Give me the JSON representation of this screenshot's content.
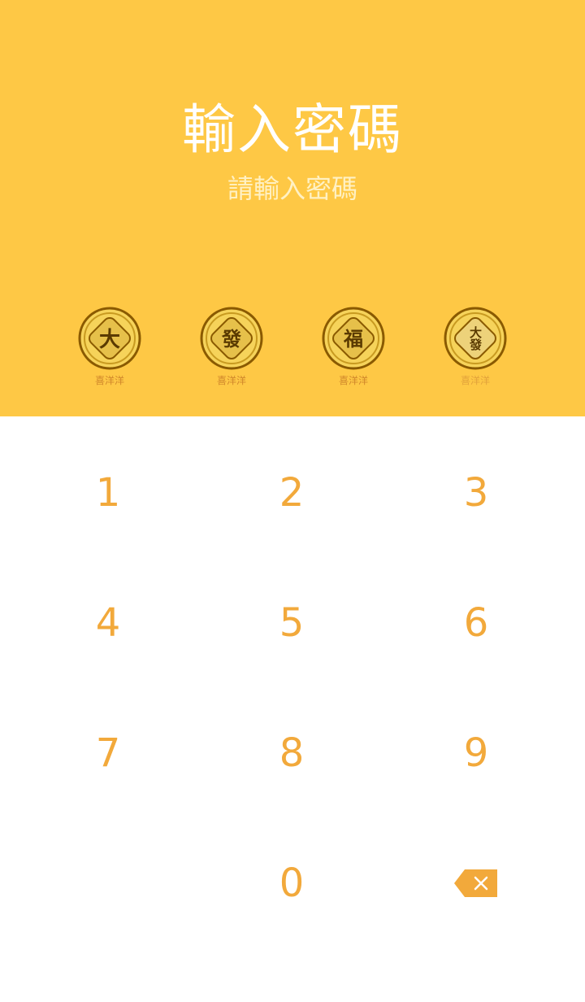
{
  "header": {
    "title": "輸入密碼",
    "subtitle": "請輸入密碼"
  },
  "passcode_dots": [
    {
      "char": "大",
      "caption": "喜洋洋"
    },
    {
      "char": "發",
      "caption": "喜洋洋"
    },
    {
      "char": "福",
      "caption": "喜洋洋"
    },
    {
      "char": "大發",
      "caption": "喜洋洋"
    }
  ],
  "keypad": {
    "k1": "1",
    "k2": "2",
    "k3": "3",
    "k4": "4",
    "k5": "5",
    "k6": "6",
    "k7": "7",
    "k8": "8",
    "k9": "9",
    "k0": "0",
    "backspace_icon": "backspace-icon"
  },
  "colors": {
    "header_bg": "#FEC845",
    "key_text": "#F2A93B",
    "coin_ring": "#8A5A00",
    "coin_face": "#E8C24A"
  }
}
